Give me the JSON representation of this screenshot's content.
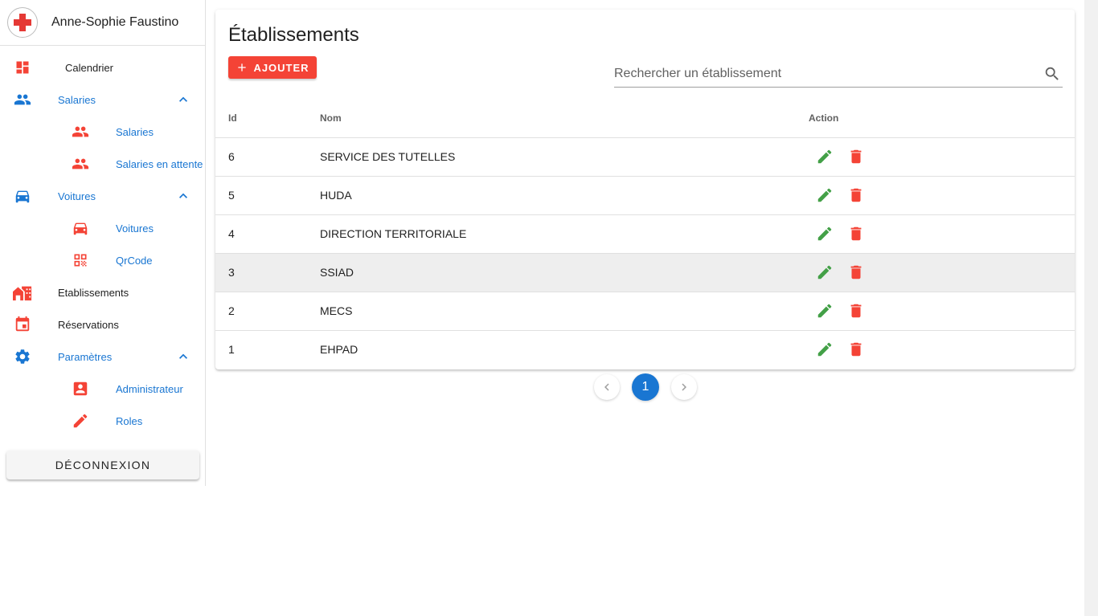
{
  "user": {
    "name": "Anne-Sophie Faustino"
  },
  "colors": {
    "primary": "#1976d2",
    "accent": "#f44336",
    "edit": "#43a047"
  },
  "sidebar": {
    "items": [
      {
        "label": "Calendrier",
        "icon": "dashboard-icon"
      },
      {
        "label": "Salaries",
        "icon": "people-icon"
      },
      {
        "label": "Salaries",
        "icon": "people-icon"
      },
      {
        "label": "Salaries en attente",
        "icon": "people-icon"
      },
      {
        "label": "Voitures",
        "icon": "car-icon"
      },
      {
        "label": "Voitures",
        "icon": "car-icon"
      },
      {
        "label": "QrCode",
        "icon": "qrcode-icon"
      },
      {
        "label": "Etablissements",
        "icon": "building-icon"
      },
      {
        "label": "Réservations",
        "icon": "calendar-icon"
      },
      {
        "label": "Paramètres",
        "icon": "gear-icon"
      },
      {
        "label": "Administrateur",
        "icon": "account-box-icon"
      },
      {
        "label": "Roles",
        "icon": "pencil-icon"
      }
    ],
    "logout_label": "DÉCONNEXION"
  },
  "main": {
    "title": "Établissements",
    "add_label": "AJOUTER",
    "search": {
      "placeholder": "Rechercher un établissement",
      "value": ""
    },
    "table": {
      "headers": {
        "id": "Id",
        "nom": "Nom",
        "action": "Action"
      },
      "rows": [
        {
          "id": "6",
          "nom": "SERVICE DES TUTELLES"
        },
        {
          "id": "5",
          "nom": "HUDA"
        },
        {
          "id": "4",
          "nom": "DIRECTION TERRITORIALE"
        },
        {
          "id": "3",
          "nom": "SSIAD"
        },
        {
          "id": "2",
          "nom": "MECS"
        },
        {
          "id": "1",
          "nom": "EHPAD"
        }
      ]
    },
    "pagination": {
      "current": "1"
    }
  }
}
